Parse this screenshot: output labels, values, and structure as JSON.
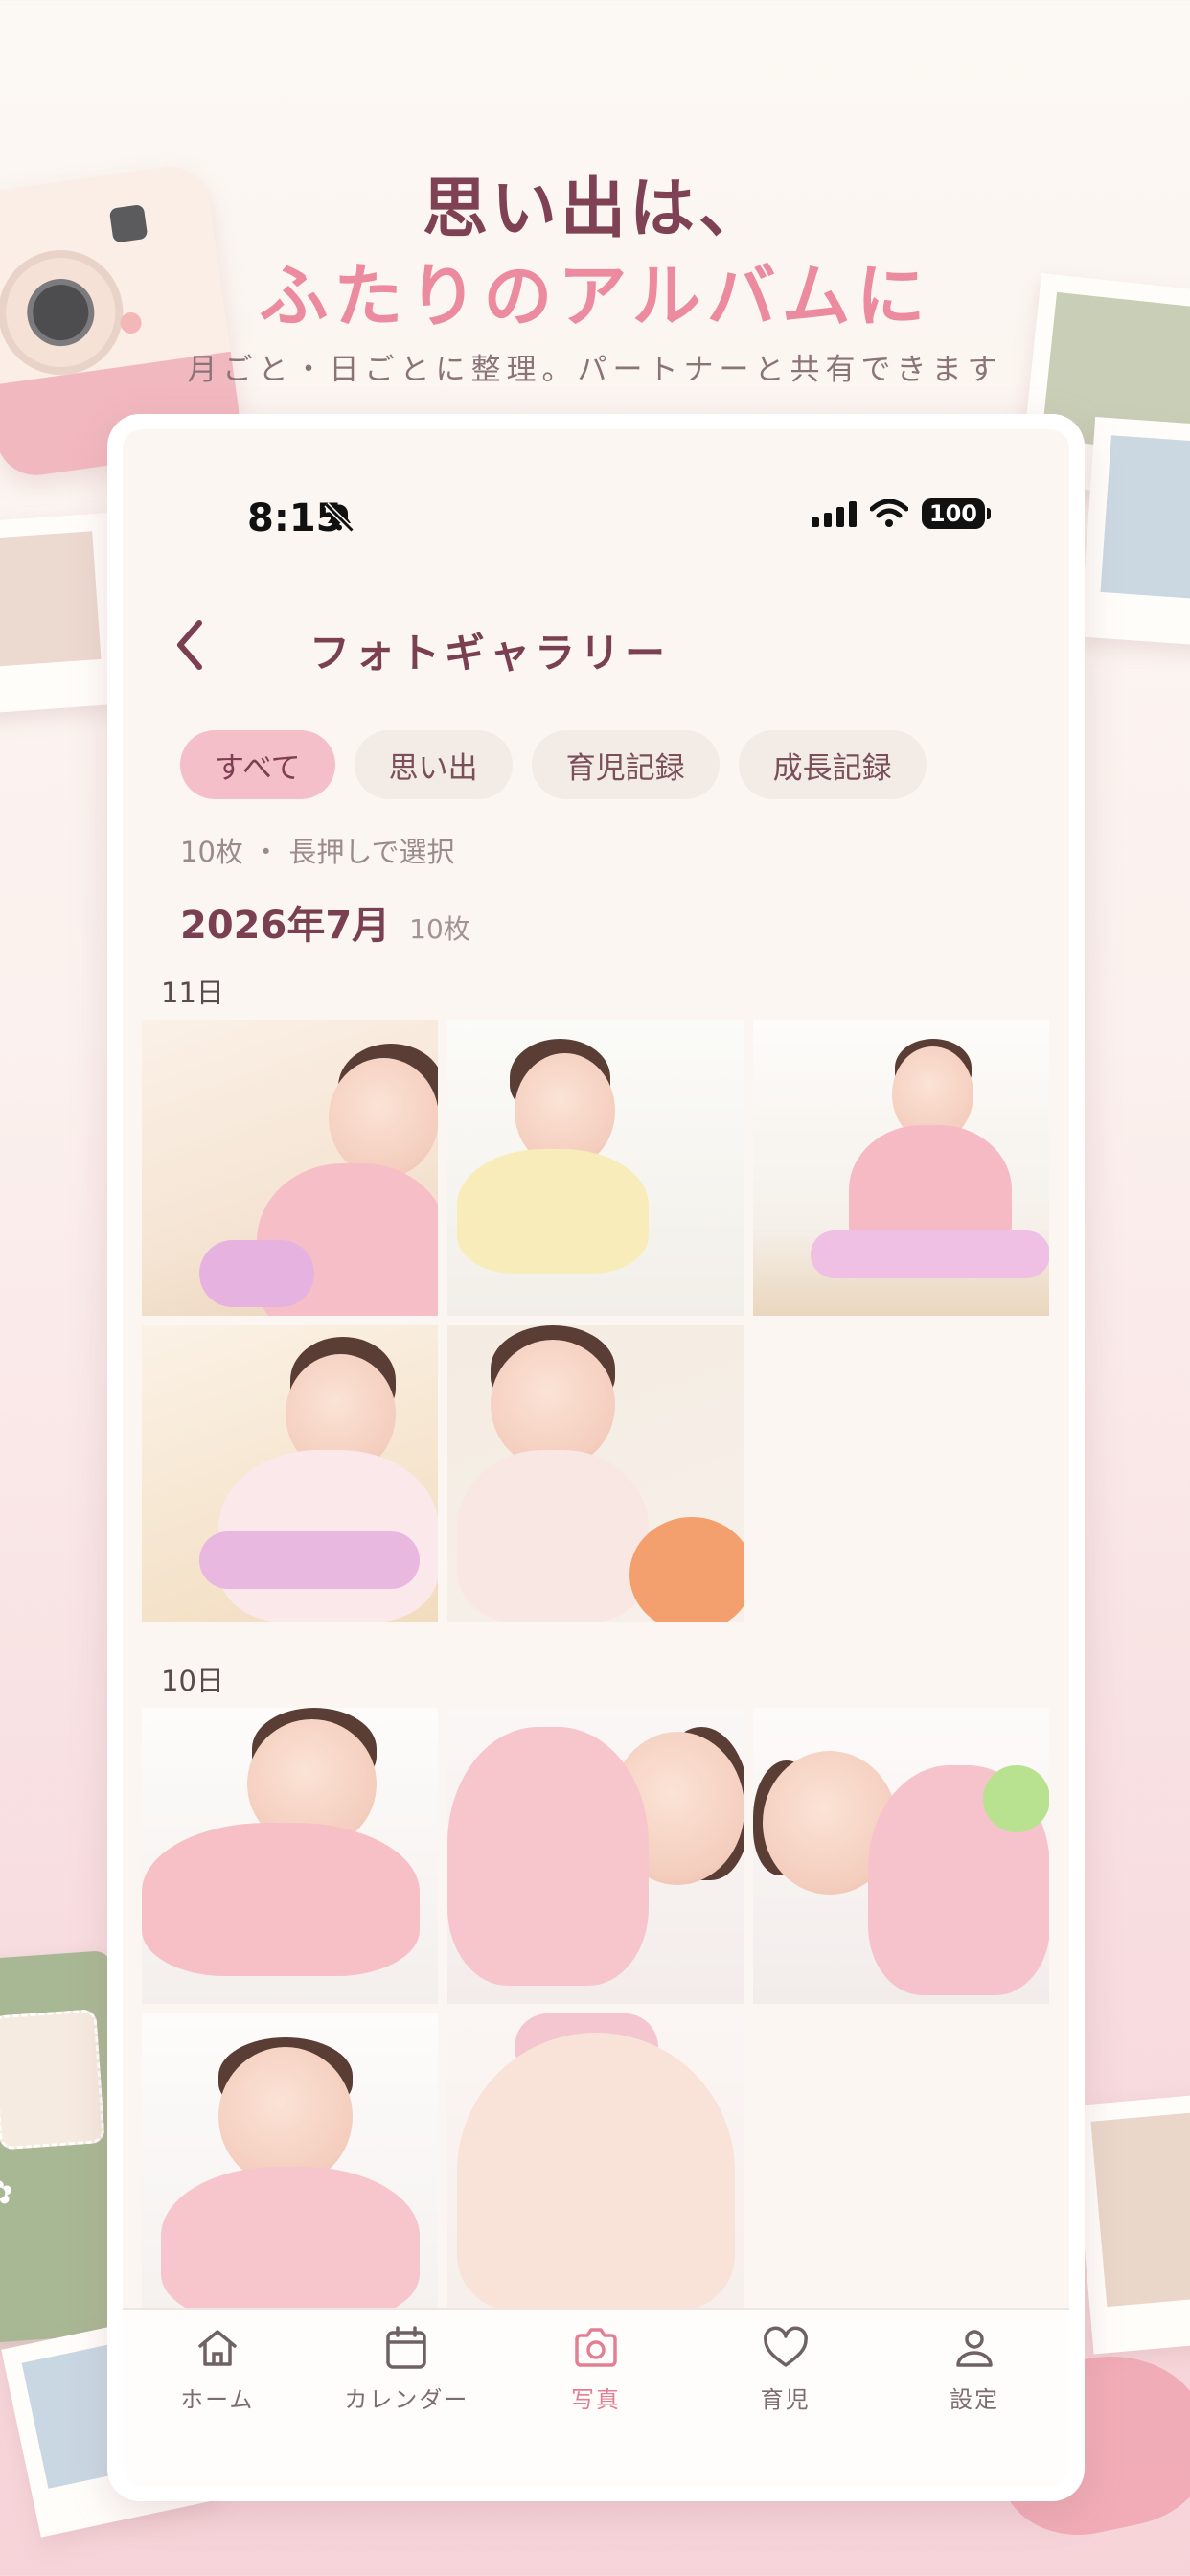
{
  "header": {
    "headline_line1": "思い出は、",
    "headline_line2": "ふたりのアルバムに",
    "subtitle": "月ごと・日ごとに整理。パートナーと共有できます"
  },
  "status_bar": {
    "time": "8:15",
    "battery": "100"
  },
  "page": {
    "title": "フォトギャラリー"
  },
  "filters": [
    {
      "label": "すべて",
      "active": true
    },
    {
      "label": "思い出",
      "active": false
    },
    {
      "label": "育児記録",
      "active": false
    },
    {
      "label": "成長記録",
      "active": false
    }
  ],
  "count_line": "10枚 ・ 長押しで選択",
  "month": {
    "title": "2026年7月",
    "count": "10枚"
  },
  "days": [
    {
      "label": "11日",
      "photos": 5
    },
    {
      "label": "10日",
      "photos": 5
    }
  ],
  "tabbar": [
    {
      "label": "ホーム",
      "icon": "home-icon",
      "active": false
    },
    {
      "label": "カレンダー",
      "icon": "calendar-icon",
      "active": false
    },
    {
      "label": "写真",
      "icon": "camera-icon",
      "active": true
    },
    {
      "label": "育児",
      "icon": "heart-icon",
      "active": false
    },
    {
      "label": "設定",
      "icon": "person-icon",
      "active": false
    }
  ],
  "colors": {
    "accent": "#e88f9f",
    "title": "#7a4052",
    "active_chip": "#f4bfc9"
  }
}
